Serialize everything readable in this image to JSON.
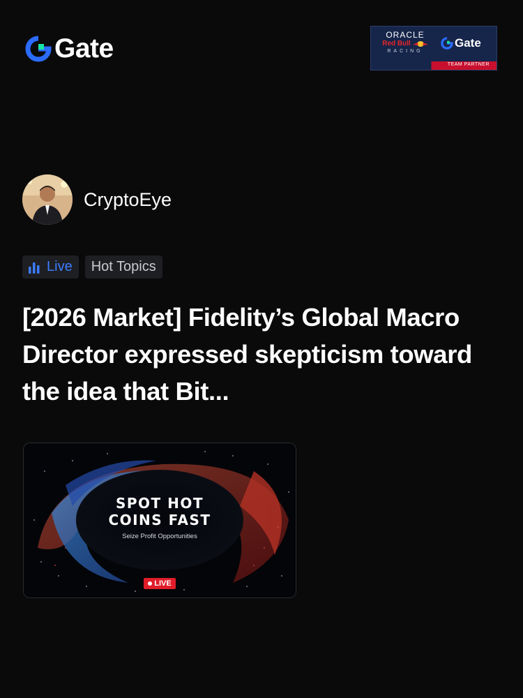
{
  "header": {
    "brand": "Gate",
    "partner": {
      "oracle": "ORACLE",
      "redbull": "Red Bull",
      "racing": "RACING",
      "gate": "Gate",
      "footer": "TEAM PARTNER"
    }
  },
  "author": {
    "name": "CryptoEye"
  },
  "tags": {
    "live": "Live",
    "topic": "Hot Topics"
  },
  "post": {
    "headline": "[2026 Market]  Fidelity’s Global Macro Director expressed skepticism toward the idea that Bit..."
  },
  "card": {
    "title": "SPOT HOT\nCOINS FAST",
    "subtitle": "Seize Profit Opportunities",
    "badge": "LIVE"
  },
  "colors": {
    "accent_blue": "#3c7cff",
    "logo_green": "#17e5a4",
    "live_red": "#e11d2a"
  }
}
